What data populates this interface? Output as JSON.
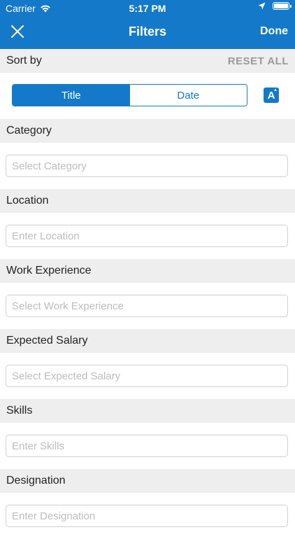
{
  "status_bar": {
    "carrier": "Carrier",
    "time": "5:17 PM"
  },
  "nav": {
    "title": "Filters",
    "done_label": "Done",
    "close_icon": "close-icon"
  },
  "sort": {
    "label": "Sort by",
    "reset_label": "RESET ALL",
    "options": [
      "Title",
      "Date"
    ],
    "selected": "Title",
    "direction_icon": "sort-alphabetical-icon",
    "direction_glyph": "A"
  },
  "filters": [
    {
      "label": "Category",
      "placeholder": "Select Category"
    },
    {
      "label": "Location",
      "placeholder": "Enter Location"
    },
    {
      "label": "Work Experience",
      "placeholder": "Select Work Experience"
    },
    {
      "label": "Expected Salary",
      "placeholder": "Select Expected Salary"
    },
    {
      "label": "Skills",
      "placeholder": "Enter Skills"
    },
    {
      "label": "Designation",
      "placeholder": "Enter Designation"
    }
  ],
  "colors": {
    "accent": "#1479c9",
    "section_bg": "#eeeeee",
    "reset": "#9a9a9a",
    "placeholder": "#bdbdbd",
    "field_border": "#d0d0d0"
  }
}
